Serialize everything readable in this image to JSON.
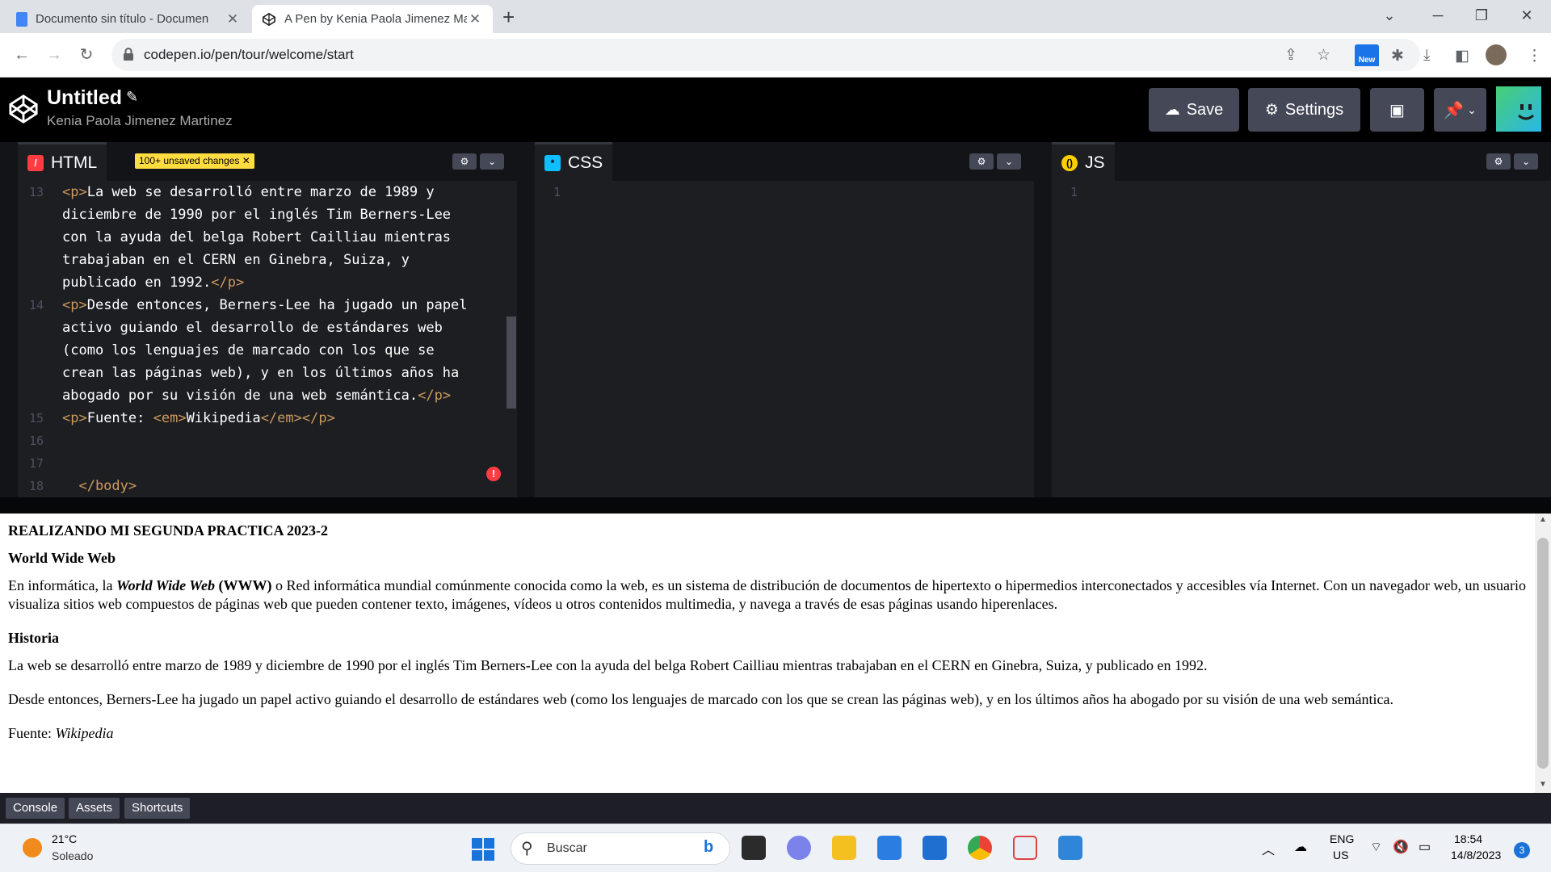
{
  "browser": {
    "tabs": [
      {
        "title": "Documento sin título - Documen",
        "icon": "google-docs-icon"
      },
      {
        "title": "A Pen by Kenia Paola Jimenez Ma",
        "icon": "codepen-icon"
      }
    ],
    "url": "codepen.io/pen/tour/welcome/start",
    "new_badge": "New"
  },
  "codepen": {
    "title": "Untitled",
    "author": "Kenia Paola Jimenez Martinez",
    "buttons": {
      "save": "Save",
      "settings": "Settings"
    },
    "unsaved": "100+ unsaved changes",
    "panes": {
      "html": "HTML",
      "css": "CSS",
      "js": "JS"
    },
    "html_code": [
      {
        "n": "13",
        "parts": [
          [
            "tag",
            "<p>"
          ],
          [
            "txt",
            "La web se desarrolló entre marzo de 1989 y"
          ]
        ]
      },
      {
        "n": "",
        "parts": [
          [
            "txt",
            "diciembre de 1990 por el inglés Tim Berners-Lee"
          ]
        ]
      },
      {
        "n": "",
        "parts": [
          [
            "txt",
            "con la ayuda del belga Robert Cailliau mientras"
          ]
        ]
      },
      {
        "n": "",
        "parts": [
          [
            "txt",
            "trabajaban en el CERN en Ginebra, Suiza, y"
          ]
        ]
      },
      {
        "n": "",
        "parts": [
          [
            "txt",
            "publicado en 1992."
          ],
          [
            "tag",
            "</p>"
          ]
        ]
      },
      {
        "n": "14",
        "parts": [
          [
            "tag",
            "<p>"
          ],
          [
            "txt",
            "Desde entonces, Berners-Lee ha jugado un papel"
          ]
        ]
      },
      {
        "n": "",
        "parts": [
          [
            "txt",
            "activo guiando el desarrollo de estándares web"
          ]
        ]
      },
      {
        "n": "",
        "parts": [
          [
            "txt",
            "(como los lenguajes de marcado con los que se"
          ]
        ]
      },
      {
        "n": "",
        "parts": [
          [
            "txt",
            "crean las páginas web), y en los últimos años ha"
          ]
        ]
      },
      {
        "n": "",
        "parts": [
          [
            "txt",
            "abogado por su visión de una web semántica."
          ],
          [
            "tag",
            "</p>"
          ]
        ]
      },
      {
        "n": "15",
        "parts": [
          [
            "tag",
            "<p>"
          ],
          [
            "txt",
            "Fuente: "
          ],
          [
            "tag",
            "<em>"
          ],
          [
            "txt",
            "Wikipedia"
          ],
          [
            "tag",
            "</em></p>"
          ]
        ]
      },
      {
        "n": "16",
        "parts": []
      },
      {
        "n": "17",
        "parts": []
      },
      {
        "n": "18",
        "parts": [
          [
            "tag",
            "  </body>"
          ]
        ]
      }
    ],
    "css_line": "1",
    "js_line": "1"
  },
  "preview": {
    "heading1": "REALIZANDO MI SEGUNDA PRACTICA 2023-2",
    "heading2": "World Wide Web",
    "p1_a": "En informática, la ",
    "p1_em": "World Wide Web",
    "p1_b": " (WWW)",
    "p1_c": " o Red informática mundial comúnmente conocida como la web, es un sistema de distribución de documentos de hipertexto o hipermedios interconectados y accesibles vía Internet. Con un navegador web, un usuario visualiza sitios web compuestos de páginas web que pueden contener texto, imágenes, vídeos u otros contenidos multimedia, y navega a través de esas páginas usando hiperenlaces.",
    "heading3": "Historia",
    "p2": "La web se desarrolló entre marzo de 1989 y diciembre de 1990 por el inglés Tim Berners-Lee con la ayuda del belga Robert Cailliau mientras trabajaban en el CERN en Ginebra, Suiza, y publicado en 1992.",
    "p3": "Desde entonces, Berners-Lee ha jugado un papel activo guiando el desarrollo de estándares web (como los lenguajes de marcado con los que se crean las páginas web), y en los últimos años ha abogado por su visión de una web semántica.",
    "p4_a": "Fuente: ",
    "p4_em": "Wikipedia"
  },
  "console_bar": {
    "console": "Console",
    "assets": "Assets",
    "shortcuts": "Shortcuts"
  },
  "taskbar": {
    "temp": "21°C",
    "condition": "Soleado",
    "search": "Buscar",
    "lang1": "ENG",
    "lang2": "US",
    "time": "18:54",
    "date": "14/8/2023",
    "notifications": "3"
  }
}
